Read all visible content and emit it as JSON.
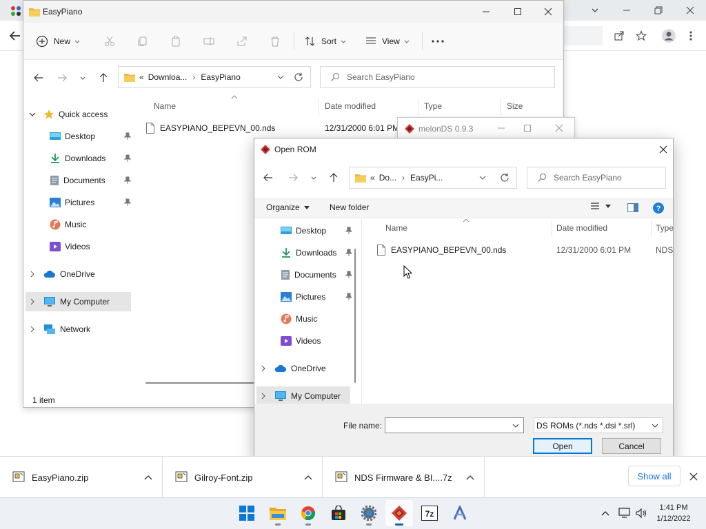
{
  "chrome": {
    "colors": {
      "accent": "#1a73e8"
    }
  },
  "explorer": {
    "title": "EasyPiano",
    "toolbar": {
      "new": "New",
      "sort": "Sort",
      "view": "View"
    },
    "address": {
      "prefix": "«",
      "part1": "Downloa...",
      "sep": "›",
      "part2": "EasyPiano"
    },
    "search_placeholder": "Search EasyPiano",
    "nav": {
      "quick_access": "Quick access",
      "items": [
        "Desktop",
        "Downloads",
        "Documents",
        "Pictures",
        "Music",
        "Videos"
      ],
      "onedrive": "OneDrive",
      "my_computer": "My Computer",
      "network": "Network"
    },
    "columns": {
      "name": "Name",
      "date": "Date modified",
      "type": "Type",
      "size": "Size"
    },
    "file": {
      "name": "EASYPIANO_BEPEVN_00.nds",
      "date": "12/31/2000 6:01 PM"
    },
    "status": "1 item"
  },
  "melon": {
    "title": "melonDS 0.9.3"
  },
  "dialog": {
    "title": "Open ROM",
    "address": {
      "prefix": "«",
      "part1": "Do...",
      "sep": "›",
      "part2": "EasyPi..."
    },
    "search_placeholder": "Search EasyPiano",
    "organize": "Organize",
    "new_folder": "New folder",
    "nav": {
      "items": [
        "Desktop",
        "Downloads",
        "Documents",
        "Pictures",
        "Music",
        "Videos"
      ],
      "onedrive": "OneDrive",
      "my_computer": "My Computer"
    },
    "columns": {
      "name": "Name",
      "date": "Date modified",
      "type": "Type"
    },
    "file": {
      "name": "EASYPIANO_BEPEVN_00.nds",
      "date": "12/31/2000 6:01 PM",
      "type": "NDS"
    },
    "file_name_label": "File name:",
    "file_name_value": "",
    "filter": "DS ROMs (*.nds *.dsi *.srl)",
    "open": "Open",
    "cancel": "Cancel"
  },
  "downloads": {
    "items": [
      {
        "name": "EasyPiano.zip"
      },
      {
        "name": "Gilroy-Font.zip"
      },
      {
        "name": "NDS Firmware & BI....7z"
      }
    ],
    "show_all": "Show all"
  },
  "taskbar": {
    "time": "1:41 PM",
    "date": "1/12/2022"
  }
}
